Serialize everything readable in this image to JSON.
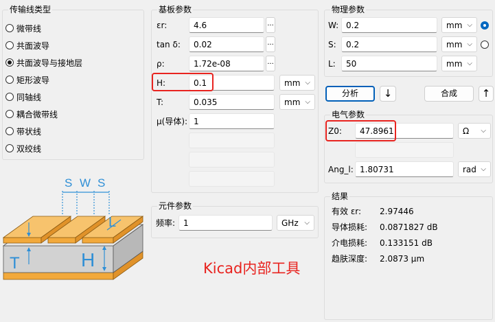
{
  "line_types": {
    "title": "传输线类型",
    "items": [
      {
        "label": "微带线",
        "checked": false
      },
      {
        "label": "共面波导",
        "checked": false
      },
      {
        "label": "共面波导与接地层",
        "checked": true
      },
      {
        "label": "矩形波导",
        "checked": false
      },
      {
        "label": "同轴线",
        "checked": false
      },
      {
        "label": "耦合微带线",
        "checked": false
      },
      {
        "label": "带状线",
        "checked": false
      },
      {
        "label": "双绞线",
        "checked": false
      }
    ]
  },
  "substrate": {
    "title": "基板参数",
    "er_label": "εr:",
    "er_value": "4.6",
    "tan_label": "tan δ:",
    "tan_value": "0.02",
    "rho_label": "ρ:",
    "rho_value": "1.72e-08",
    "h_label": "H:",
    "h_value": "0.1",
    "h_unit": "mm",
    "t_label": "T:",
    "t_value": "0.035",
    "t_unit": "mm",
    "mu_label": "μ(导体):",
    "mu_value": "1",
    "dots": "..."
  },
  "component": {
    "title": "元件参数",
    "freq_label": "频率:",
    "freq_value": "1",
    "freq_unit": "GHz"
  },
  "physical": {
    "title": "物理参数",
    "w_label": "W:",
    "w_value": "0.2",
    "w_unit": "mm",
    "s_label": "S:",
    "s_value": "0.2",
    "s_unit": "mm",
    "l_label": "L:",
    "l_value": "50",
    "l_unit": "mm"
  },
  "actions": {
    "analyze": "分析",
    "synthesize": "合成",
    "down_arrow": "↓",
    "up_arrow": "↑"
  },
  "electrical": {
    "title": "电气参数",
    "z0_label": "Z0:",
    "z0_value": "47.8961",
    "z0_unit": "Ω",
    "ang_label": "Ang_l:",
    "ang_value": "1.80731",
    "ang_unit": "rad"
  },
  "results": {
    "title": "结果",
    "rows": [
      {
        "label": "有效 εr:",
        "value": "2.97446"
      },
      {
        "label": "导体损耗:",
        "value": "0.0871827 dB"
      },
      {
        "label": "介电损耗:",
        "value": "0.133151 dB"
      },
      {
        "label": "趋肤深度:",
        "value": "2.0873 μm"
      }
    ]
  },
  "diagram": {
    "s_label": "S",
    "w_label": "W",
    "l_label": "L",
    "t_label": "T",
    "h_label": "H"
  },
  "annotation": "Kicad内部工具",
  "colors": {
    "copper": "#f2a93b",
    "substrate": "#d0d0d0",
    "dimension": "#2f8fd6",
    "highlight": "#e8231f",
    "annotation": "#e8231f"
  }
}
